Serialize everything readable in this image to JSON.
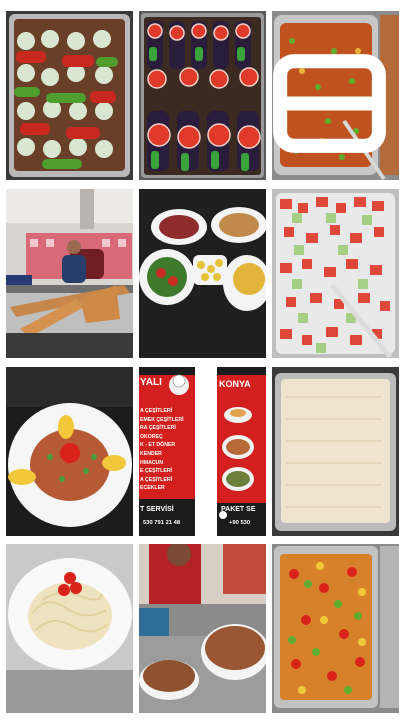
{
  "gallery": {
    "tiles": [
      {
        "name": "stuffed-peppers-tray"
      },
      {
        "name": "eggplant-kebab-tray"
      },
      {
        "name": "stew-tray"
      },
      {
        "name": "chef-oven-lahmacun"
      },
      {
        "name": "table-dishes"
      },
      {
        "name": "tomato-cucumber-salad"
      },
      {
        "name": "carpaccio-plate"
      },
      {
        "name": "menu-banner"
      },
      {
        "name": "rice-pilaf-tray"
      },
      {
        "name": "pasta-plate"
      },
      {
        "name": "lahmacun-stack"
      },
      {
        "name": "vegetable-stew-tray"
      }
    ]
  },
  "banner": {
    "left_title": "YALI",
    "right_title": "KONYA",
    "menu_items": [
      "A ÇEŞİTLERİ",
      "EMEK ÇEŞİTLERİ",
      "RA ÇEŞİTLERİ",
      "OKOREÇ",
      "K - ET DÖNER",
      "KENDER",
      "HMACUN",
      "E ÇEŞİTLERİ",
      "A ÇEŞİTLERİ",
      "ECEKLER"
    ],
    "left_service": "T SERVİSİ",
    "left_phone": "530 791 21 48",
    "right_service": "PAKET SE",
    "right_phone": "+90 530",
    "red": "#d3201f"
  }
}
